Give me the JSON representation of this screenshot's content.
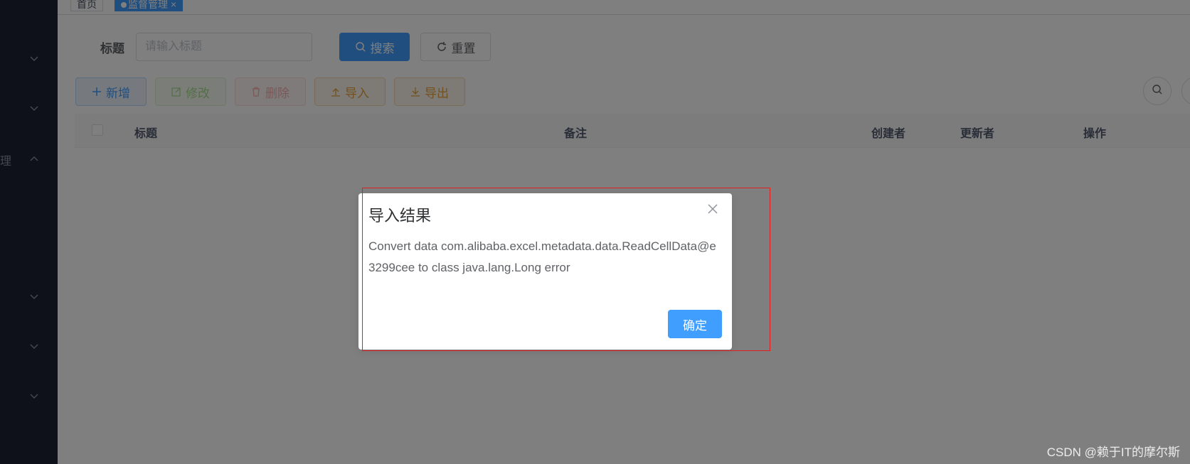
{
  "sidebar": {
    "items": [
      {
        "label": "",
        "expanded": false
      },
      {
        "label": "",
        "expanded": false
      },
      {
        "label": "理",
        "expanded": true
      },
      {
        "label": "",
        "expanded": false
      },
      {
        "label": "",
        "expanded": false
      },
      {
        "label": "",
        "expanded": false
      }
    ]
  },
  "tags": {
    "home": "首页",
    "active": "监督管理",
    "close": "×"
  },
  "search": {
    "title_label": "标题",
    "title_placeholder": "请输入标题",
    "search_button": "搜索",
    "reset_button": "重置"
  },
  "toolbar": {
    "add": "新增",
    "edit": "修改",
    "delete": "删除",
    "import": "导入",
    "export": "导出"
  },
  "table": {
    "columns": [
      "标题",
      "备注",
      "创建者",
      "更新者",
      "操作"
    ]
  },
  "dialog": {
    "title": "导入结果",
    "message": "Convert data com.alibaba.excel.metadata.data.ReadCellData@e3299cee to class java.lang.Long error",
    "confirm": "确定"
  },
  "watermark": "CSDN @赖于IT的摩尔斯",
  "colors": {
    "primary": "#409eff",
    "sidebar": "#1d2233",
    "highlight_box": "#e02020"
  }
}
